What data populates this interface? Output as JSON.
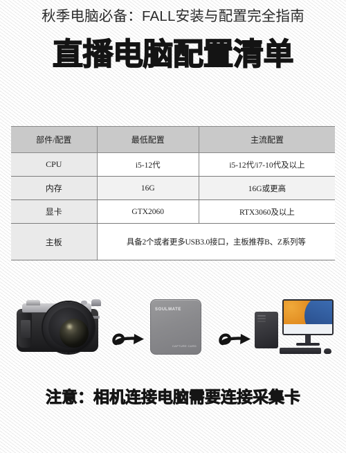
{
  "header": {
    "title": "秋季电脑必备：FALL安装与配置完全指南"
  },
  "banner": {
    "heading": "直播电脑配置清单"
  },
  "table": {
    "columns": [
      "部件/配置",
      "最低配置",
      "主流配置"
    ],
    "rows": [
      {
        "label": "CPU",
        "min": "i5-12代",
        "mainstream": "i5-12代/i7-10代及以上",
        "merged": false
      },
      {
        "label": "内存",
        "min": "16G",
        "mainstream": "16G或更高",
        "merged": false
      },
      {
        "label": "显卡",
        "min": "GTX2060",
        "mainstream": "RTX3060及以上",
        "merged": false
      },
      {
        "label": "主板",
        "min": "",
        "mainstream": "",
        "merged": true,
        "merged_text": "具备2个或者更多USB3.0接口，主板推荐B、Z系列等"
      }
    ]
  },
  "illustration": {
    "camera": {
      "name": "mirrorless-camera",
      "brand_mark": ""
    },
    "arrow_1": {
      "name": "curly-arrow-right"
    },
    "capture_card": {
      "brand": "SOULMATE",
      "subtext": "CAPTURE CARD"
    },
    "arrow_2": {
      "name": "curly-arrow-right"
    },
    "computer": {
      "name": "desktop-computer"
    }
  },
  "notice": {
    "text": "注意：相机连接电脑需要连接采集卡"
  },
  "colors": {
    "page_background": "#f3f3f3",
    "table_header_bg": "#c9c9c9",
    "table_label_bg": "#eaeaea",
    "table_row_shaded_bg": "#f2f2f2",
    "table_border": "#7b7b7b",
    "text_dark": "#151515",
    "monitor_accent_orange": "#e08a1f",
    "monitor_accent_blue": "#2e5696"
  }
}
